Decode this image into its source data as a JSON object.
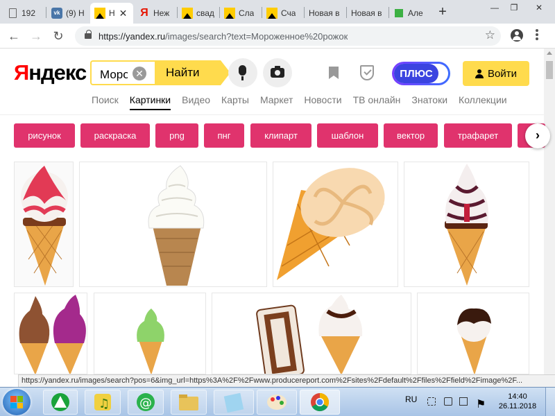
{
  "browser": {
    "tabs": [
      {
        "label": "192",
        "icon": "document-icon",
        "active": false
      },
      {
        "label": "(9) Н",
        "icon": "vk-icon",
        "active": false
      },
      {
        "label": "Н",
        "icon": "yandex-images-icon",
        "active": true
      },
      {
        "label": "Неж",
        "icon": "yandex-icon",
        "active": false
      },
      {
        "label": "свад",
        "icon": "yandex-images-icon",
        "active": false
      },
      {
        "label": "Сла",
        "icon": "yandex-images-icon",
        "active": false
      },
      {
        "label": "Сча",
        "icon": "yandex-images-icon",
        "active": false
      },
      {
        "label": "Новая в",
        "icon": "",
        "active": false
      },
      {
        "label": "Новая в",
        "icon": "",
        "active": false
      },
      {
        "label": "Але",
        "icon": "green-square-icon",
        "active": false
      }
    ],
    "new_tab": "+",
    "window_controls": {
      "minimize": "—",
      "restore": "❐",
      "close": "✕"
    },
    "url_host": "https://yandex.ru",
    "url_rest": "/images/search?text=Мороженное%20рожок",
    "status_url": "https://yandex.ru/images/search?pos=6&img_url=https%3A%2F%2Fwww.producereport.com%2Fsites%2Fdefault%2Ffiles%2Ffield%2Fimage%2F..."
  },
  "yandex": {
    "logo_first": "Я",
    "logo_rest": "ндекс",
    "search_value": "Мороженное рожок",
    "search_button": "Найти",
    "clear_symbol": "✕",
    "plus_label": "ПЛЮС",
    "login_label": "Войти",
    "services": [
      "Поиск",
      "Картинки",
      "Видео",
      "Карты",
      "Маркет",
      "Новости",
      "ТВ онлайн",
      "Знатоки",
      "Коллекции"
    ],
    "active_service": "Картинки",
    "chips": [
      "рисунок",
      "раскраска",
      "png",
      "пнг",
      "клипарт",
      "шаблон",
      "вектор",
      "трафарет"
    ],
    "chips_next": "›"
  },
  "images": [
    {
      "name": "strawberry-cone"
    },
    {
      "name": "soft-serve-cone"
    },
    {
      "name": "big-waffle-cone"
    },
    {
      "name": "chocolate-drizzle-cone"
    },
    {
      "name": "chocolate-berry-cones"
    },
    {
      "name": "mint-cone"
    },
    {
      "name": "packaged-ice-cream-and-cone"
    },
    {
      "name": "chocolate-dipped-cone"
    }
  ],
  "taskbar": {
    "lang": "RU",
    "time": "14:40",
    "date": "26.11.2018"
  },
  "colors": {
    "accent_yellow": "#ffdb4d",
    "chip_pink": "#e0336d",
    "yandex_red": "#ff0000",
    "plus_blue": "#3b44e0"
  }
}
